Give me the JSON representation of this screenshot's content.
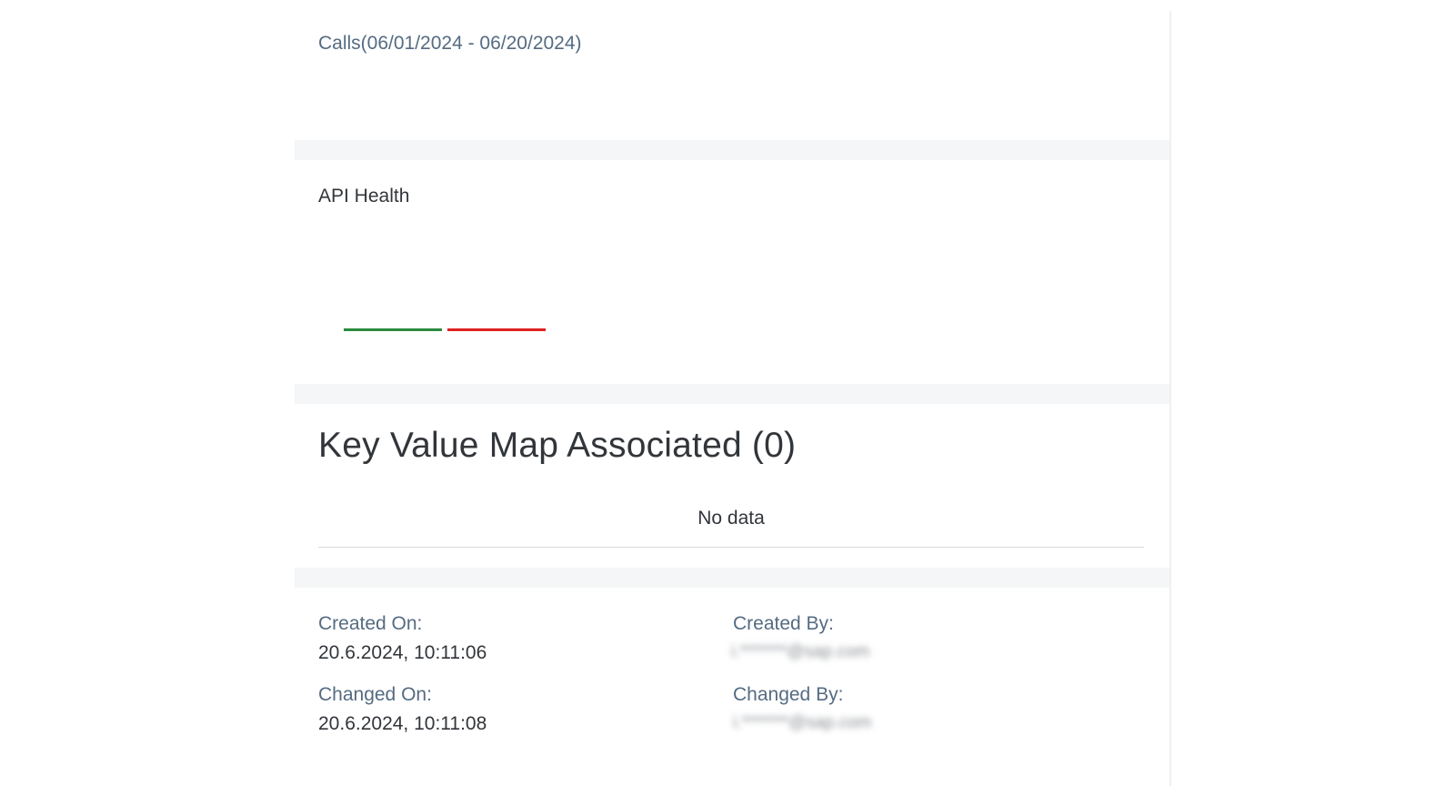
{
  "calls": {
    "title": "Calls(06/01/2024 - 06/20/2024)"
  },
  "api_health": {
    "title": "API Health",
    "bar_colors": {
      "success": "#2b8a3e",
      "error": "#e02020"
    }
  },
  "kvm": {
    "title": "Key Value Map Associated (0)",
    "empty_text": "No data"
  },
  "metadata": {
    "created_on_label": "Created On:",
    "created_on_value": "20.6.2024, 10:11:06",
    "created_by_label": "Created By:",
    "created_by_value": "i.*******@sap.com",
    "changed_on_label": "Changed On:",
    "changed_on_value": "20.6.2024, 10:11:08",
    "changed_by_label": "Changed By:",
    "changed_by_value": "i.*******@sap.com"
  }
}
